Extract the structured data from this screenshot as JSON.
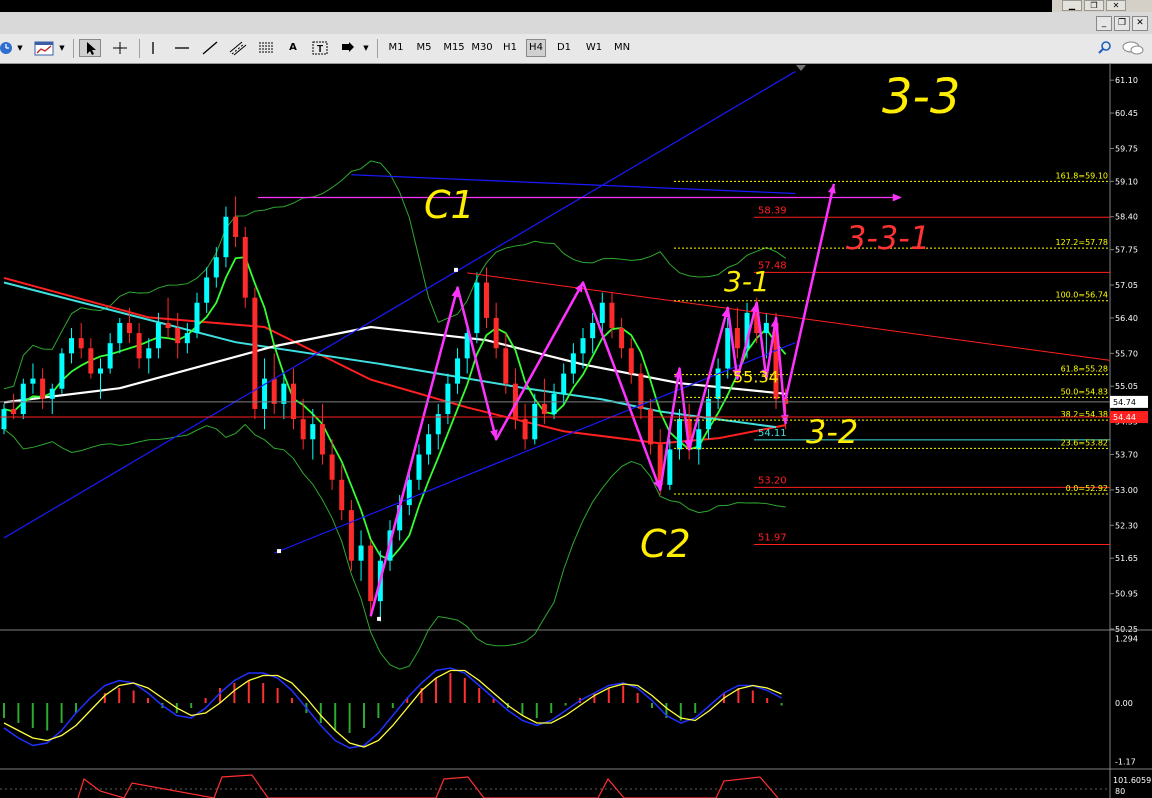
{
  "window": {
    "controls": [
      "minimize",
      "restore",
      "close"
    ],
    "mdi_controls": [
      "minimize",
      "restore",
      "close"
    ]
  },
  "toolbar": {
    "tools": [
      "clock-icon",
      "chart-template-icon",
      "cursor-icon",
      "crosshair-icon",
      "vertical-line-icon",
      "horizontal-line-icon",
      "trendline-icon",
      "equidistant-channel-icon",
      "fibonacci-icon",
      "text-icon",
      "text-label-icon",
      "arrow-icon"
    ],
    "tool_letters": {
      "text": "A",
      "text_label": "T"
    },
    "timeframes": [
      "M1",
      "M5",
      "M15",
      "M30",
      "H1",
      "H4",
      "D1",
      "W1",
      "MN"
    ],
    "active_timeframe": "H4",
    "right_icons": [
      "search-icon",
      "chat-icon"
    ]
  },
  "colors": {
    "background": "#000000",
    "bull_candle": "#00ffff",
    "bear_candle": "#ff2a2a",
    "ma_white": "#ffffff",
    "ma_cyan": "#40e0e0",
    "ma_red": "#ff2020",
    "ma_green": "#33ff33",
    "bollinger": "#2ea82e",
    "channel": "#1a1aff",
    "annotation_magenta": "#ff33ff",
    "annotation_yellow": "#ffee00",
    "annotation_red": "#ff3333",
    "fib": "#ffff00",
    "macd_up": "#ff3030",
    "macd_down": "#2ea82e"
  },
  "chart_data": {
    "type": "candlestick",
    "price_axis": {
      "ticks": [
        "61.10",
        "60.45",
        "59.75",
        "59.10",
        "58.40",
        "57.75",
        "57.05",
        "56.40",
        "55.70",
        "55.05",
        "54.35",
        "53.70",
        "53.00",
        "52.30",
        "51.65",
        "50.95",
        "50.25"
      ],
      "range": [
        50.25,
        61.4
      ],
      "current_price": "54.74",
      "current_price_red": "54.44"
    },
    "ohlc": [
      [
        54.2,
        54.7,
        54.1,
        54.6
      ],
      [
        54.6,
        54.9,
        54.4,
        54.5
      ],
      [
        54.5,
        55.2,
        54.4,
        55.1
      ],
      [
        55.1,
        55.5,
        54.9,
        55.2
      ],
      [
        55.2,
        55.4,
        54.6,
        54.8
      ],
      [
        54.8,
        55.1,
        54.5,
        55.0
      ],
      [
        55.0,
        55.8,
        54.9,
        55.7
      ],
      [
        55.7,
        56.2,
        55.5,
        56.0
      ],
      [
        56.0,
        56.3,
        55.6,
        55.8
      ],
      [
        55.8,
        56.0,
        55.2,
        55.3
      ],
      [
        55.3,
        55.6,
        54.8,
        55.4
      ],
      [
        55.4,
        56.1,
        55.3,
        55.9
      ],
      [
        55.9,
        56.4,
        55.7,
        56.3
      ],
      [
        56.3,
        56.6,
        55.9,
        56.1
      ],
      [
        56.1,
        56.3,
        55.4,
        55.6
      ],
      [
        55.6,
        56.0,
        55.3,
        55.8
      ],
      [
        55.8,
        56.5,
        55.6,
        56.3
      ],
      [
        56.3,
        56.8,
        56.0,
        56.2
      ],
      [
        56.2,
        56.5,
        55.6,
        55.9
      ],
      [
        55.9,
        56.3,
        55.7,
        56.1
      ],
      [
        56.1,
        56.9,
        56.0,
        56.7
      ],
      [
        56.7,
        57.4,
        56.5,
        57.2
      ],
      [
        57.2,
        57.8,
        57.0,
        57.6
      ],
      [
        57.6,
        58.6,
        57.4,
        58.4
      ],
      [
        58.4,
        58.8,
        57.8,
        58.0
      ],
      [
        58.0,
        58.2,
        56.6,
        56.8
      ],
      [
        56.8,
        57.0,
        54.4,
        54.6
      ],
      [
        54.6,
        55.6,
        54.2,
        55.2
      ],
      [
        55.2,
        55.7,
        54.5,
        54.7
      ],
      [
        54.7,
        55.3,
        54.4,
        55.1
      ],
      [
        55.1,
        55.4,
        54.2,
        54.4
      ],
      [
        54.4,
        54.8,
        53.8,
        54.0
      ],
      [
        54.0,
        54.6,
        53.6,
        54.3
      ],
      [
        54.3,
        54.7,
        53.5,
        53.7
      ],
      [
        53.7,
        54.0,
        53.0,
        53.2
      ],
      [
        53.2,
        53.5,
        52.4,
        52.6
      ],
      [
        52.6,
        52.8,
        51.4,
        51.6
      ],
      [
        51.6,
        52.2,
        51.2,
        51.9
      ],
      [
        51.9,
        52.0,
        50.5,
        50.8
      ],
      [
        50.8,
        51.8,
        50.4,
        51.6
      ],
      [
        51.6,
        52.4,
        51.4,
        52.2
      ],
      [
        52.2,
        52.9,
        52.0,
        52.7
      ],
      [
        52.7,
        53.4,
        52.5,
        53.2
      ],
      [
        53.2,
        53.9,
        53.0,
        53.7
      ],
      [
        53.7,
        54.3,
        53.5,
        54.1
      ],
      [
        54.1,
        54.7,
        53.8,
        54.5
      ],
      [
        54.5,
        55.3,
        54.3,
        55.1
      ],
      [
        55.1,
        55.8,
        54.9,
        55.6
      ],
      [
        55.6,
        56.3,
        55.3,
        56.1
      ],
      [
        56.1,
        57.3,
        55.9,
        57.1
      ],
      [
        57.1,
        57.4,
        56.2,
        56.4
      ],
      [
        56.4,
        56.7,
        55.6,
        55.8
      ],
      [
        55.8,
        56.1,
        54.9,
        55.1
      ],
      [
        55.1,
        55.4,
        54.2,
        54.4
      ],
      [
        54.4,
        54.7,
        53.8,
        54.0
      ],
      [
        54.0,
        54.9,
        53.9,
        54.7
      ],
      [
        54.7,
        55.2,
        54.3,
        54.5
      ],
      [
        54.5,
        55.1,
        54.4,
        54.9
      ],
      [
        54.9,
        55.5,
        54.7,
        55.3
      ],
      [
        55.3,
        55.9,
        55.1,
        55.7
      ],
      [
        55.7,
        56.2,
        55.4,
        56.0
      ],
      [
        56.0,
        56.5,
        55.7,
        56.3
      ],
      [
        56.3,
        56.9,
        56.1,
        56.7
      ],
      [
        56.7,
        56.9,
        56.0,
        56.2
      ],
      [
        56.2,
        56.4,
        55.6,
        55.8
      ],
      [
        55.8,
        56.0,
        55.1,
        55.3
      ],
      [
        55.3,
        55.5,
        54.4,
        54.6
      ],
      [
        54.6,
        54.8,
        53.7,
        53.9
      ],
      [
        53.9,
        54.2,
        52.9,
        53.1
      ],
      [
        53.1,
        54.0,
        53.0,
        53.8
      ],
      [
        53.8,
        54.6,
        53.6,
        54.4
      ],
      [
        54.4,
        54.7,
        53.6,
        53.8
      ],
      [
        53.8,
        54.4,
        53.5,
        54.2
      ],
      [
        54.2,
        55.0,
        54.0,
        54.8
      ],
      [
        54.8,
        55.6,
        54.6,
        55.4
      ],
      [
        55.4,
        56.4,
        55.2,
        56.2
      ],
      [
        56.2,
        56.6,
        55.6,
        55.8
      ],
      [
        55.8,
        56.7,
        55.6,
        56.5
      ],
      [
        56.5,
        56.8,
        55.9,
        56.1
      ],
      [
        56.1,
        56.5,
        55.6,
        56.3
      ],
      [
        56.3,
        56.5,
        54.6,
        54.8
      ],
      [
        54.8,
        55.0,
        54.2,
        54.7
      ]
    ],
    "moving_averages": {
      "cyan": [
        [
          0,
          57.1
        ],
        [
          24,
          55.92
        ],
        [
          39,
          55.49
        ],
        [
          54,
          55.01
        ],
        [
          62,
          54.79
        ],
        [
          68,
          54.55
        ],
        [
          80,
          54.24
        ]
      ],
      "white": [
        [
          0,
          54.73
        ],
        [
          12,
          55.01
        ],
        [
          28,
          55.84
        ],
        [
          38,
          56.22
        ],
        [
          50,
          55.96
        ],
        [
          60,
          55.48
        ],
        [
          70,
          55.11
        ],
        [
          81,
          54.9
        ]
      ],
      "red": [
        [
          0,
          57.19
        ],
        [
          15,
          56.41
        ],
        [
          27,
          56.22
        ],
        [
          38,
          55.18
        ],
        [
          48,
          54.63
        ],
        [
          58,
          54.16
        ],
        [
          68,
          53.92
        ],
        [
          74,
          54.02
        ],
        [
          81,
          54.28
        ]
      ]
    },
    "channel_lines": [
      {
        "from": [
          0,
          52.05
        ],
        "to": [
          82,
          61.27
        ]
      },
      {
        "from": [
          28,
          51.75
        ],
        "to": [
          82,
          55.91
        ]
      },
      {
        "from": [
          36,
          59.23
        ],
        "to": [
          82,
          58.86
        ]
      }
    ],
    "horizontal_levels": [
      {
        "label": "58.39",
        "price": 58.39,
        "color": "#ff2020"
      },
      {
        "label": "57.48",
        "price": 57.3,
        "color": "#ff2020"
      },
      {
        "label": "54.11",
        "price": 53.99,
        "color": "#40e0e0"
      },
      {
        "label": "53.20",
        "price": 53.05,
        "color": "#ff2020"
      },
      {
        "label": "51.97",
        "price": 51.92,
        "color": "#ff2020"
      }
    ],
    "fibonacci": {
      "levels": [
        {
          "label": "161.8=59.10",
          "price": 59.1
        },
        {
          "label": "127.2=57.78",
          "price": 57.78
        },
        {
          "label": "100.0=56.74",
          "price": 56.74
        },
        {
          "label": "61.8=55.28",
          "price": 55.28
        },
        {
          "label": "50.0=54.83",
          "price": 54.83
        },
        {
          "label": "38.2=54.38",
          "price": 54.38
        },
        {
          "label": "23.6=53.82",
          "price": 53.82
        },
        {
          "label": "0.0=52.92",
          "price": 52.92
        }
      ]
    },
    "annotations": {
      "magenta_path": [
        [
          38,
          50.5
        ],
        [
          47,
          57.0
        ],
        [
          51,
          54.0
        ],
        [
          60,
          57.1
        ],
        [
          68,
          53.0
        ],
        [
          70,
          55.4
        ],
        [
          71,
          53.8
        ],
        [
          75,
          56.6
        ],
        [
          76,
          55.2
        ],
        [
          78,
          56.7
        ],
        [
          79,
          55.2
        ],
        [
          80,
          56.4
        ],
        [
          81,
          54.3
        ]
      ],
      "magenta_arrow": {
        "from": [
          81,
          54.8
        ],
        "to": [
          86,
          59.05
        ]
      },
      "magenta_h_arrow": {
        "from": [
          25,
          58.78
        ],
        "to": [
          90,
          58.78
        ]
      },
      "red_trendline": {
        "from": [
          48,
          57.29
        ],
        "to": [
          82,
          55.82
        ]
      },
      "handwritten": [
        {
          "text": "C1",
          "color": "#ffee00"
        },
        {
          "text": "C2",
          "color": "#ffee00"
        },
        {
          "text": "3-3",
          "color": "#ffee00"
        },
        {
          "text": "3-1",
          "color": "#ffee00"
        },
        {
          "text": "3-2",
          "color": "#ffee00"
        },
        {
          "text": "3-3-1",
          "color": "#ff3333"
        }
      ],
      "price_note": "55.34"
    },
    "macd": {
      "axis_labels": [
        "1.294",
        "0.00",
        "-1.17"
      ],
      "histogram": [
        -0.3,
        -0.4,
        -0.5,
        -0.55,
        -0.4,
        -0.2,
        0.0,
        0.2,
        0.3,
        0.25,
        0.1,
        -0.1,
        -0.2,
        -0.1,
        0.1,
        0.3,
        0.4,
        0.45,
        0.4,
        0.3,
        0.1,
        -0.2,
        -0.4,
        -0.55,
        -0.6,
        -0.5,
        -0.3,
        -0.1,
        0.1,
        0.3,
        0.5,
        0.6,
        0.5,
        0.3,
        0.1,
        -0.1,
        -0.25,
        -0.3,
        -0.2,
        -0.05,
        0.1,
        0.2,
        0.3,
        0.35,
        0.2,
        -0.1,
        -0.3,
        -0.35,
        -0.2,
        0.0,
        0.2,
        0.3,
        0.25,
        0.1,
        -0.05
      ],
      "main": [
        -0.5,
        -0.7,
        -0.85,
        -0.8,
        -0.55,
        -0.2,
        0.1,
        0.35,
        0.45,
        0.4,
        0.2,
        -0.05,
        -0.25,
        -0.3,
        -0.1,
        0.2,
        0.45,
        0.6,
        0.6,
        0.5,
        0.25,
        -0.1,
        -0.45,
        -0.75,
        -0.9,
        -0.85,
        -0.6,
        -0.25,
        0.1,
        0.4,
        0.65,
        0.7,
        0.6,
        0.35,
        0.1,
        -0.15,
        -0.35,
        -0.45,
        -0.35,
        -0.15,
        0.05,
        0.2,
        0.35,
        0.4,
        0.3,
        0.05,
        -0.25,
        -0.4,
        -0.3,
        -0.05,
        0.2,
        0.35,
        0.35,
        0.25,
        0.1
      ],
      "signal": [
        -0.4,
        -0.55,
        -0.7,
        -0.75,
        -0.65,
        -0.45,
        -0.15,
        0.15,
        0.35,
        0.4,
        0.3,
        0.1,
        -0.1,
        -0.25,
        -0.2,
        0.0,
        0.25,
        0.45,
        0.55,
        0.55,
        0.4,
        0.1,
        -0.25,
        -0.55,
        -0.8,
        -0.88,
        -0.75,
        -0.45,
        -0.1,
        0.25,
        0.5,
        0.65,
        0.65,
        0.45,
        0.2,
        -0.05,
        -0.25,
        -0.4,
        -0.4,
        -0.25,
        -0.05,
        0.15,
        0.3,
        0.38,
        0.35,
        0.15,
        -0.1,
        -0.3,
        -0.35,
        -0.15,
        0.1,
        0.28,
        0.35,
        0.3,
        0.18
      ]
    },
    "stoch_axis_labels": [
      "101.6059",
      "80"
    ]
  }
}
